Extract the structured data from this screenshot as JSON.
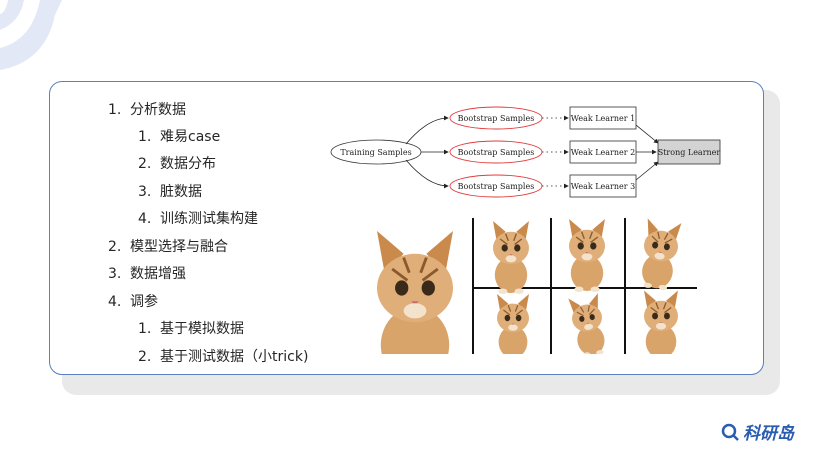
{
  "outline": [
    {
      "num": "1.",
      "text": "分析数据",
      "level": 1
    },
    {
      "num": "1.",
      "text": "难易case",
      "level": 2
    },
    {
      "num": "2.",
      "text": "数据分布",
      "level": 2
    },
    {
      "num": "3.",
      "text": "脏数据",
      "level": 2
    },
    {
      "num": "4.",
      "text": "训练测试集构建",
      "level": 2
    },
    {
      "num": "2.",
      "text": "模型选择与融合",
      "level": 1
    },
    {
      "num": "3.",
      "text": "数据增强",
      "level": 1
    },
    {
      "num": "4.",
      "text": "调参",
      "level": 1
    },
    {
      "num": "1.",
      "text": "基于模拟数据",
      "level": 2
    },
    {
      "num": "2.",
      "text": "基于测试数据（小trick)",
      "level": 2
    }
  ],
  "diagram": {
    "training": "Training Samples",
    "bootstrap": [
      "Bootstrap Samples",
      "Bootstrap Samples",
      "Bootstrap Samples"
    ],
    "weak": [
      "Weak Learner 1",
      "Weak Learner 2",
      "Weak Learner 3"
    ],
    "strong": "Strong Learner"
  },
  "logo": {
    "text": "科研岛",
    "icon": "magnifier-q-icon"
  },
  "colors": {
    "card_border": "#5b7fc0",
    "bootstrap_stroke": "#e23b3b",
    "strong_fill": "#d3d3d3",
    "logo": "#2a5db0"
  }
}
